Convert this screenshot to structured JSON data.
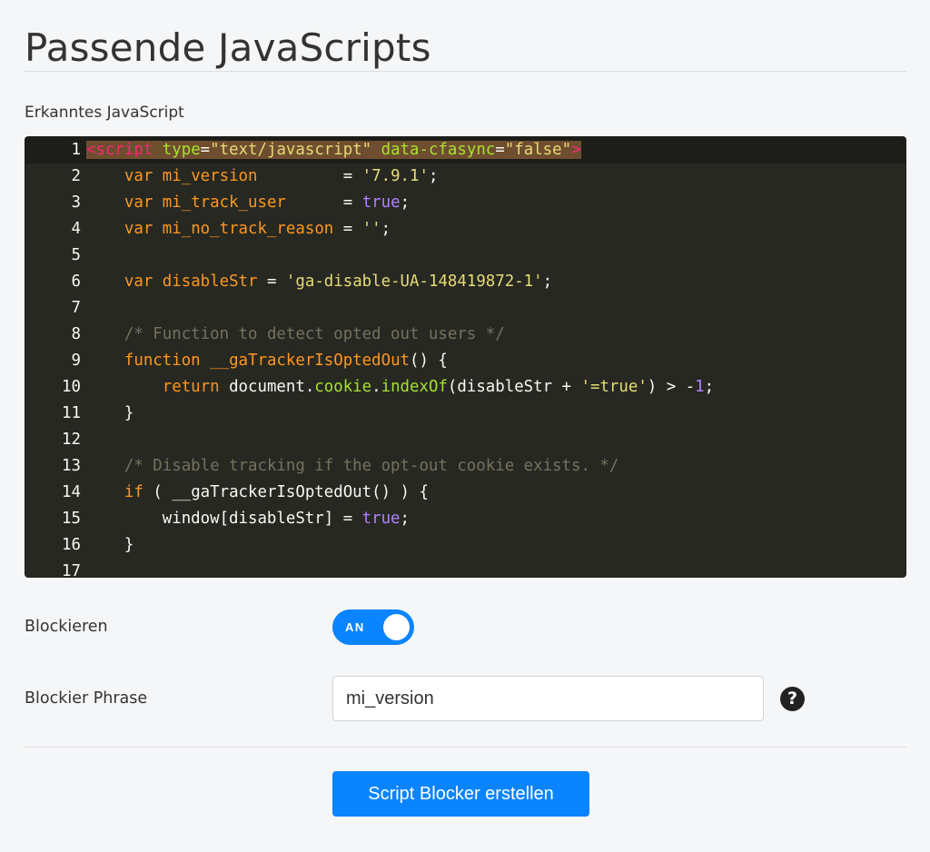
{
  "page": {
    "title": "Passende JavaScripts",
    "section_label": "Erkanntes JavaScript"
  },
  "editor": {
    "lines": [
      {
        "n": "1",
        "tokens": [
          [
            "t-tag hl",
            "<script"
          ],
          [
            "t-plain hl",
            " "
          ],
          [
            "t-attr hl",
            "type"
          ],
          [
            "t-plain hl",
            "="
          ],
          [
            "t-str hl",
            "\"text/javascript\""
          ],
          [
            "t-plain hl",
            " "
          ],
          [
            "t-attr hl",
            "data-cfasync"
          ],
          [
            "t-plain hl",
            "="
          ],
          [
            "t-str hl",
            "\"false\""
          ],
          [
            "t-tag hl",
            ">"
          ]
        ]
      },
      {
        "n": "2",
        "tokens": [
          [
            "t-plain",
            "    "
          ],
          [
            "k-o",
            "var"
          ],
          [
            "t-plain",
            " "
          ],
          [
            "k-o",
            "mi_version"
          ],
          [
            "t-plain",
            "         = "
          ],
          [
            "t-str",
            "'7.9.1'"
          ],
          [
            "t-plain",
            ";"
          ]
        ]
      },
      {
        "n": "3",
        "tokens": [
          [
            "t-plain",
            "    "
          ],
          [
            "k-o",
            "var"
          ],
          [
            "t-plain",
            " "
          ],
          [
            "k-o",
            "mi_track_user"
          ],
          [
            "t-plain",
            "      = "
          ],
          [
            "t-bool",
            "true"
          ],
          [
            "t-plain",
            ";"
          ]
        ]
      },
      {
        "n": "4",
        "tokens": [
          [
            "t-plain",
            "    "
          ],
          [
            "k-o",
            "var"
          ],
          [
            "t-plain",
            " "
          ],
          [
            "k-o",
            "mi_no_track_reason"
          ],
          [
            "t-plain",
            " = "
          ],
          [
            "t-str",
            "''"
          ],
          [
            "t-plain",
            ";"
          ]
        ]
      },
      {
        "n": "5",
        "tokens": []
      },
      {
        "n": "6",
        "tokens": [
          [
            "t-plain",
            "    "
          ],
          [
            "k-o",
            "var"
          ],
          [
            "t-plain",
            " "
          ],
          [
            "k-o",
            "disableStr"
          ],
          [
            "t-plain",
            " = "
          ],
          [
            "t-str",
            "'ga-disable-UA-148419872-1'"
          ],
          [
            "t-plain",
            ";"
          ]
        ]
      },
      {
        "n": "7",
        "tokens": []
      },
      {
        "n": "8",
        "tokens": [
          [
            "t-plain",
            "    "
          ],
          [
            "t-cmt",
            "/* Function to detect opted out users */"
          ]
        ]
      },
      {
        "n": "9",
        "tokens": [
          [
            "t-plain",
            "    "
          ],
          [
            "k-o",
            "function"
          ],
          [
            "t-plain",
            " "
          ],
          [
            "k-o",
            "__gaTrackerIsOptedOut"
          ],
          [
            "t-plain",
            "() {"
          ]
        ]
      },
      {
        "n": "10",
        "tokens": [
          [
            "t-plain",
            "        "
          ],
          [
            "k-o",
            "return"
          ],
          [
            "t-plain",
            " document."
          ],
          [
            "t-prop",
            "cookie"
          ],
          [
            "t-plain",
            "."
          ],
          [
            "t-prop",
            "indexOf"
          ],
          [
            "t-plain",
            "(disableStr + "
          ],
          [
            "t-str",
            "'=true'"
          ],
          [
            "t-plain",
            ") > -"
          ],
          [
            "t-num",
            "1"
          ],
          [
            "t-plain",
            ";"
          ]
        ]
      },
      {
        "n": "11",
        "tokens": [
          [
            "t-plain",
            "    }"
          ]
        ]
      },
      {
        "n": "12",
        "tokens": []
      },
      {
        "n": "13",
        "tokens": [
          [
            "t-plain",
            "    "
          ],
          [
            "t-cmt",
            "/* Disable tracking if the opt-out cookie exists. */"
          ]
        ]
      },
      {
        "n": "14",
        "tokens": [
          [
            "t-plain",
            "    "
          ],
          [
            "k-o",
            "if"
          ],
          [
            "t-plain",
            " ( __gaTrackerIsOptedOut() ) {"
          ]
        ]
      },
      {
        "n": "15",
        "tokens": [
          [
            "t-plain",
            "        window[disableStr] = "
          ],
          [
            "t-bool",
            "true"
          ],
          [
            "t-plain",
            ";"
          ]
        ]
      },
      {
        "n": "16",
        "tokens": [
          [
            "t-plain",
            "    }"
          ]
        ]
      },
      {
        "n": "17",
        "tokens": []
      }
    ]
  },
  "block": {
    "label": "Blockieren",
    "toggle_text": "AN"
  },
  "phrase": {
    "label": "Blockier Phrase",
    "value": "mi_version",
    "help_icon": "question-circle-icon",
    "help_glyph": "?"
  },
  "actions": {
    "create_label": "Script Blocker erstellen"
  },
  "colors": {
    "accent": "#0a84ff",
    "editor_bg": "#272822"
  }
}
